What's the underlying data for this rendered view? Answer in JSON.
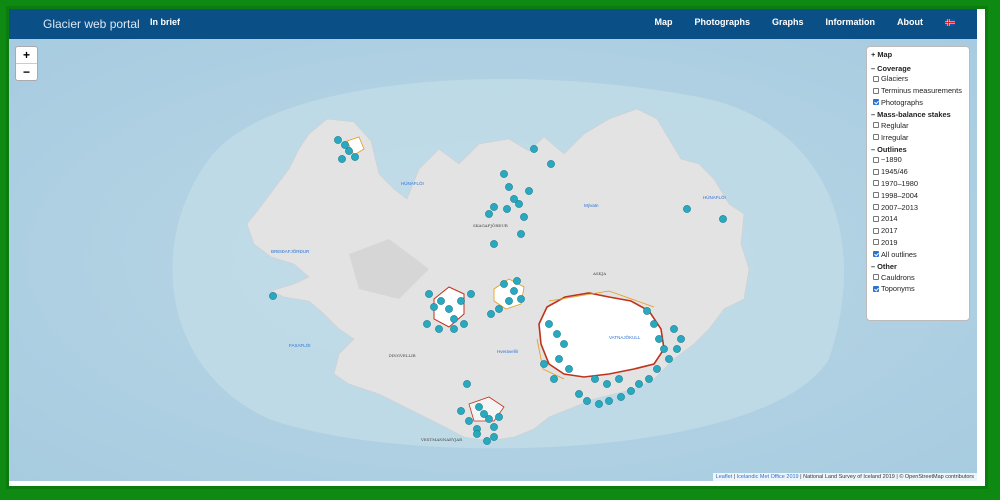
{
  "navbar": {
    "brand": "Glacier web portal",
    "left_link": "In brief",
    "links": [
      "Map",
      "Photographs",
      "Graphs",
      "Information",
      "About"
    ]
  },
  "zoom": {
    "in": "+",
    "out": "−"
  },
  "layers": {
    "header": "+ Map",
    "groups": [
      {
        "title": "Coverage",
        "items": [
          {
            "label": "Glaciers",
            "checked": false
          },
          {
            "label": "Terminus measurements",
            "checked": false
          },
          {
            "label": "Photographs",
            "checked": true
          }
        ]
      },
      {
        "title": "Mass-balance stakes",
        "items": [
          {
            "label": "Reglular",
            "checked": false
          },
          {
            "label": "Irregular",
            "checked": false
          }
        ]
      },
      {
        "title": "Outlines",
        "items": [
          {
            "label": "~1890",
            "checked": false
          },
          {
            "label": "1945/46",
            "checked": false
          },
          {
            "label": "1970–1980",
            "checked": false
          },
          {
            "label": "1998–2004",
            "checked": false
          },
          {
            "label": "2007–2013",
            "checked": false
          },
          {
            "label": "2014",
            "checked": false
          },
          {
            "label": "2017",
            "checked": false
          },
          {
            "label": "2019",
            "checked": false
          },
          {
            "label": "All outlines",
            "checked": true
          }
        ]
      },
      {
        "title": "Other",
        "items": [
          {
            "label": "Cauldrons",
            "checked": false
          },
          {
            "label": "Toponyms",
            "checked": true
          }
        ]
      }
    ]
  },
  "attribution": {
    "leaflet": "Leaflet",
    "met": "Icelandic Met Office 2019",
    "rest": "| National Land Survey of Iceland 2019 | © OpenStreetMap contributors"
  },
  "toponyms": {
    "hunafloi": "HÚNAFLÓI",
    "hunafloi2": "HÚNAFLÓI",
    "hunafloi3": "HÚNAFLÓI",
    "skagafjordur": "SKAGAFJÖRÐUR",
    "myvatn": "Mývatn",
    "hnafloi": "HÚNAFLÓI",
    "breidafjordur": "BREIÐAFJÖRÐUR",
    "faxafloi": "FAXAFLÓI",
    "askja": "ASKJA",
    "thingvellir": "ÞINGVELLIR",
    "hornafjordur": "HORNAFJÖRÐUR",
    "vatna": "VATNAJÖKULL",
    "hofsjokull": "HOFSJÖKULL",
    "langjokull": "LANGJÖKULL",
    "heklustadir": "Hveravellir",
    "vestmannaeyjar": "VESTMANNAEYJAR"
  },
  "colors": {
    "navbar": "#0a4f86",
    "marker": "#29a9bf",
    "sea": "#cfe3ea",
    "land": "#e2e2e2",
    "outline": "#c0321b"
  }
}
